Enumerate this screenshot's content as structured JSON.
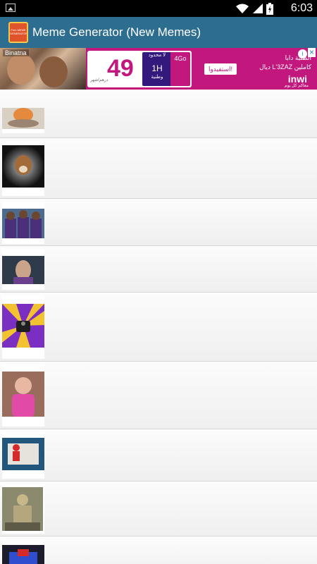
{
  "status_bar": {
    "time": "6:03",
    "icons": [
      "notification-icon",
      "wifi-icon",
      "signal-icon",
      "battery-icon"
    ]
  },
  "app_bar": {
    "title": "Meme Generator (New Memes)",
    "icon_text": "Free MEME GENERATOR"
  },
  "ad": {
    "brand_tag": "Binatna",
    "offer_number": "49",
    "offer_small": "درهم/شهر",
    "pack_top": "لا محدود",
    "pack_hours": "1H",
    "pack_bottom": "وطنية",
    "data_label": "4Go",
    "cta": "استفيدوا!",
    "headline": "الطلبة دابا",
    "subline": "ديال L'3ZAZ كاملين",
    "operator": "inwi",
    "tagline": "معاكم كل يوم",
    "info_label": "i",
    "close_label": "×"
  },
  "meme_list": {
    "items": [
      {
        "name": "meme-item-1",
        "thumb": "egg-face"
      },
      {
        "name": "meme-item-2",
        "thumb": "cat-face"
      },
      {
        "name": "meme-item-3",
        "thumb": "football-players"
      },
      {
        "name": "meme-item-4",
        "thumb": "gymnast-face"
      },
      {
        "name": "meme-item-5",
        "thumb": "purple-yellow-rays"
      },
      {
        "name": "meme-item-6",
        "thumb": "toddler-pink"
      },
      {
        "name": "meme-item-7",
        "thumb": "spiderman-scene"
      },
      {
        "name": "meme-item-8",
        "thumb": "ancient-figure"
      },
      {
        "name": "meme-item-9",
        "thumb": "superhero-partial"
      }
    ]
  }
}
